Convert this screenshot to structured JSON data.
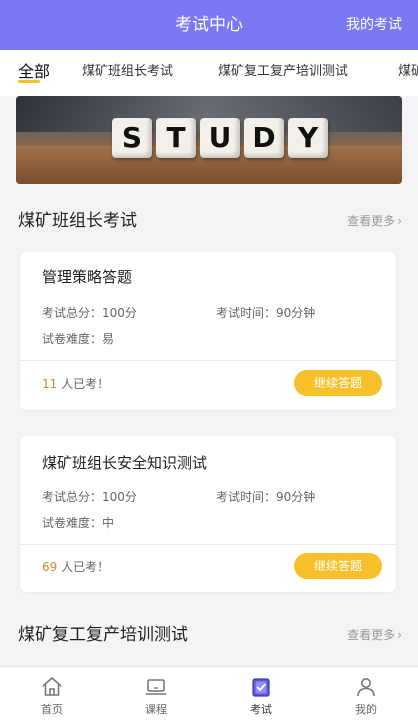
{
  "header": {
    "title": "考试中心",
    "right_link": "我的考试"
  },
  "tabs": [
    {
      "label": "全部",
      "active": true
    },
    {
      "label": "煤矿班组长考试",
      "active": false
    },
    {
      "label": "煤矿复工复产培训测试",
      "active": false
    },
    {
      "label": "煤矿",
      "active": false
    }
  ],
  "banner": {
    "letters": [
      "S",
      "T",
      "U",
      "D",
      "Y"
    ]
  },
  "sections": [
    {
      "title": "煤矿班组长考试",
      "more": "查看更多",
      "cards": [
        {
          "name": "管理策略答题",
          "total_label": "考试总分：",
          "total_value": "100分",
          "time_label": "考试时间：",
          "time_value": "90分钟",
          "difficulty_label": "试卷难度：",
          "difficulty_value": "易",
          "count": "11",
          "count_suffix": " 人已考！",
          "button": "继续答题"
        },
        {
          "name": "煤矿班组长安全知识测试",
          "total_label": "考试总分：",
          "total_value": "100分",
          "time_label": "考试时间：",
          "time_value": "90分钟",
          "difficulty_label": "试卷难度：",
          "difficulty_value": "中",
          "count": "69",
          "count_suffix": " 人已考！",
          "button": "继续答题"
        }
      ]
    },
    {
      "title": "煤矿复工复产培训测试",
      "more": "查看更多"
    }
  ],
  "bottom_nav": [
    {
      "label": "首页",
      "icon": "home-icon"
    },
    {
      "label": "课程",
      "icon": "laptop-icon"
    },
    {
      "label": "考试",
      "icon": "exam-icon",
      "active": true
    },
    {
      "label": "我的",
      "icon": "user-icon"
    }
  ],
  "colors": {
    "header": "#7b79f2",
    "accent": "#f6c02a",
    "count": "#d08a27"
  }
}
